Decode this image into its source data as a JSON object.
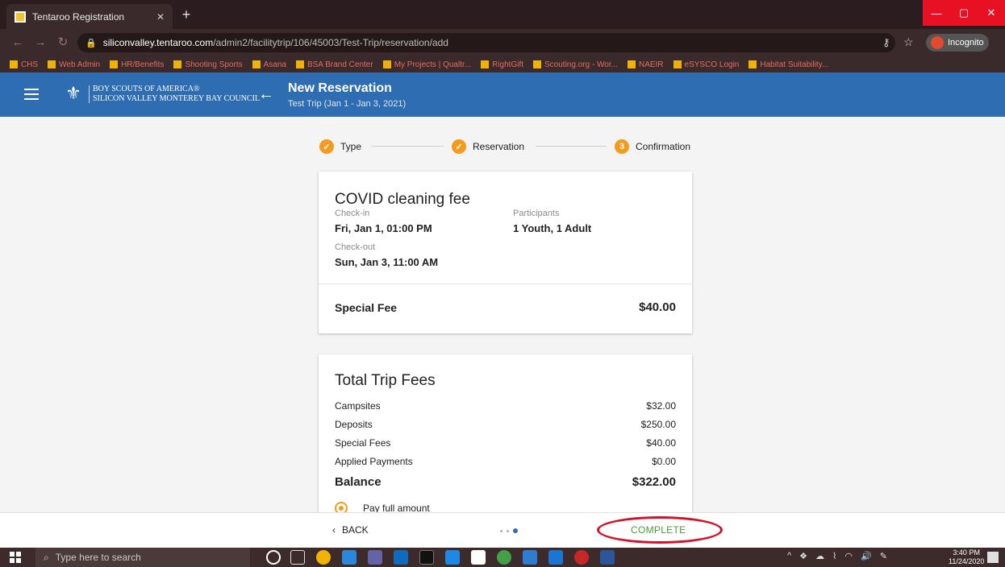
{
  "browser": {
    "tab_title": "Tentaroo Registration",
    "url_host": "siliconvalley.tentaroo.com",
    "url_path": "/admin2/facilitytrip/106/45003/Test-Trip/reservation/add",
    "incognito_label": "Incognito",
    "bookmarks": [
      "CHS",
      "Web Admin",
      "HR/Benefits",
      "Shooting Sports",
      "Asana",
      "BSA Brand Center",
      "My Projects | Qualtr...",
      "RightGift",
      "Scouting.org - Wor...",
      "NAEIR",
      "eSYSCO Login",
      "Habitat Suitability..."
    ]
  },
  "header": {
    "org_line1": "BOY SCOUTS OF AMERICA®",
    "org_line2": "SILICON VALLEY MONTEREY BAY COUNCIL",
    "title": "New Reservation",
    "subtitle": "Test Trip (Jan 1 - Jan 3, 2021)"
  },
  "stepper": {
    "steps": [
      {
        "label": "Type",
        "state": "done"
      },
      {
        "label": "Reservation",
        "state": "done"
      },
      {
        "label": "Confirmation",
        "state": "current",
        "number": "3"
      }
    ]
  },
  "reservation": {
    "title": "COVID cleaning fee",
    "checkin_label": "Check-in",
    "checkin_value": "Fri, Jan 1, 01:00 PM",
    "participants_label": "Participants",
    "participants_value": "1 Youth, 1 Adult",
    "checkout_label": "Check-out",
    "checkout_value": "Sun, Jan 3, 11:00 AM",
    "fee_label": "Special Fee",
    "fee_amount": "$40.00"
  },
  "totals": {
    "title": "Total Trip Fees",
    "rows": [
      {
        "label": "Campsites",
        "amount": "$32.00"
      },
      {
        "label": "Deposits",
        "amount": "$250.00"
      },
      {
        "label": "Special Fees",
        "amount": "$40.00"
      },
      {
        "label": "Applied Payments",
        "amount": "$0.00"
      }
    ],
    "balance_label": "Balance",
    "balance_amount": "$322.00",
    "pay_option": "Pay full amount"
  },
  "actions": {
    "back_label": "BACK",
    "complete_label": "COMPLETE"
  },
  "taskbar": {
    "search_placeholder": "Type here to search",
    "time": "3:40 PM",
    "date": "11/24/2020"
  },
  "colors": {
    "header_blue": "#2f6db3",
    "step_orange": "#f49a1d",
    "complete_green": "#4e9a3a",
    "annotation_red": "#d3122a"
  }
}
